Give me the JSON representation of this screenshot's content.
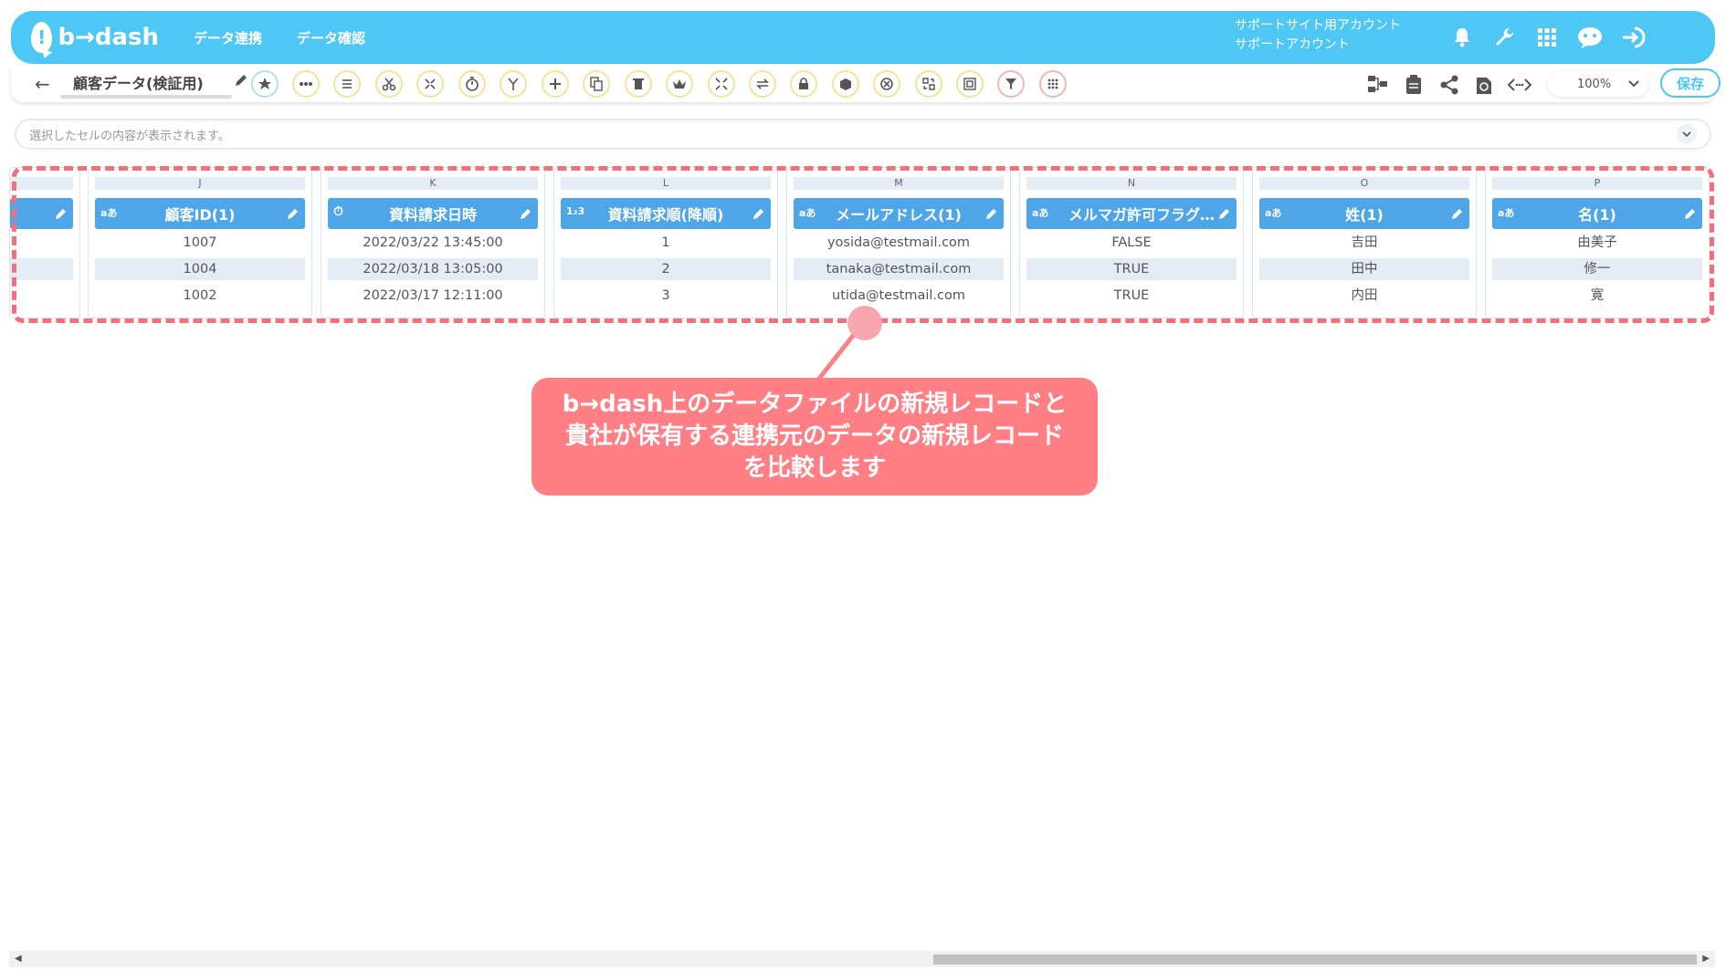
{
  "header": {
    "logo_text": "b→dash",
    "logo_glyph": "!",
    "nav": [
      "データ連携",
      "データ確認"
    ],
    "account_line1": "サポートサイト用アカウント",
    "account_line2": "サポートアカウント",
    "icons": [
      "bell-icon",
      "wrench-icon",
      "apps-grid-icon",
      "chat-bot-icon",
      "logout-icon"
    ]
  },
  "toolbar": {
    "back_icon": "←",
    "file_title": "顧客データ(検証用)",
    "zoom_value": "100%",
    "save_label": "保存",
    "tool_icons": [
      "star-icon",
      "more-icon",
      "list-icon",
      "scissors-icon",
      "merge-icon",
      "timer-icon",
      "branch-icon",
      "plus-icon",
      "copy-icon",
      "trash-icon",
      "crown-icon",
      "expand-icon",
      "swap-icon",
      "lock-icon",
      "package-icon",
      "cancel-icon",
      "replace-icon",
      "frame-icon",
      "filter-icon",
      "grid-dots-icon"
    ]
  },
  "cellbar": {
    "placeholder": "選択したセルの内容が表示されます。"
  },
  "columns": [
    {
      "letter": "",
      "name": "",
      "type": "",
      "cells": [
        "",
        "",
        ""
      ]
    },
    {
      "letter": "J",
      "name": "顧客ID(1)",
      "type": "aあ",
      "cells": [
        "1007",
        "1004",
        "1002"
      ]
    },
    {
      "letter": "K",
      "name": "資料請求日時",
      "type": "⏱",
      "cells": [
        "2022/03/22 13:45:00",
        "2022/03/18 13:05:00",
        "2022/03/17 12:11:00"
      ]
    },
    {
      "letter": "L",
      "name": "資料請求順(降順)",
      "type": "1₂3",
      "cells": [
        "1",
        "2",
        "3"
      ]
    },
    {
      "letter": "M",
      "name": "メールアドレス(1)",
      "type": "aあ",
      "cells": [
        "yosida@testmail.com",
        "tanaka@testmail.com",
        "utida@testmail.com"
      ]
    },
    {
      "letter": "N",
      "name": "メルマガ許可フラグ…",
      "type": "aあ",
      "cells": [
        "FALSE",
        "TRUE",
        "TRUE"
      ]
    },
    {
      "letter": "O",
      "name": "姓(1)",
      "type": "aあ",
      "cells": [
        "吉田",
        "田中",
        "内田"
      ]
    },
    {
      "letter": "P",
      "name": "名(1)",
      "type": "aあ",
      "cells": [
        "由美子",
        "修一",
        "寛"
      ]
    }
  ],
  "callout": {
    "line1": "b→dash上のデータファイルの新規レコードと",
    "line2": "貴社が保有する連携元のデータの新規レコード",
    "line3": "を比較します"
  },
  "colors": {
    "brand": "#4ec7f5",
    "header_blue": "#4ea6e8",
    "highlight": "#f0707c",
    "callout_bg": "#ff7f85"
  }
}
